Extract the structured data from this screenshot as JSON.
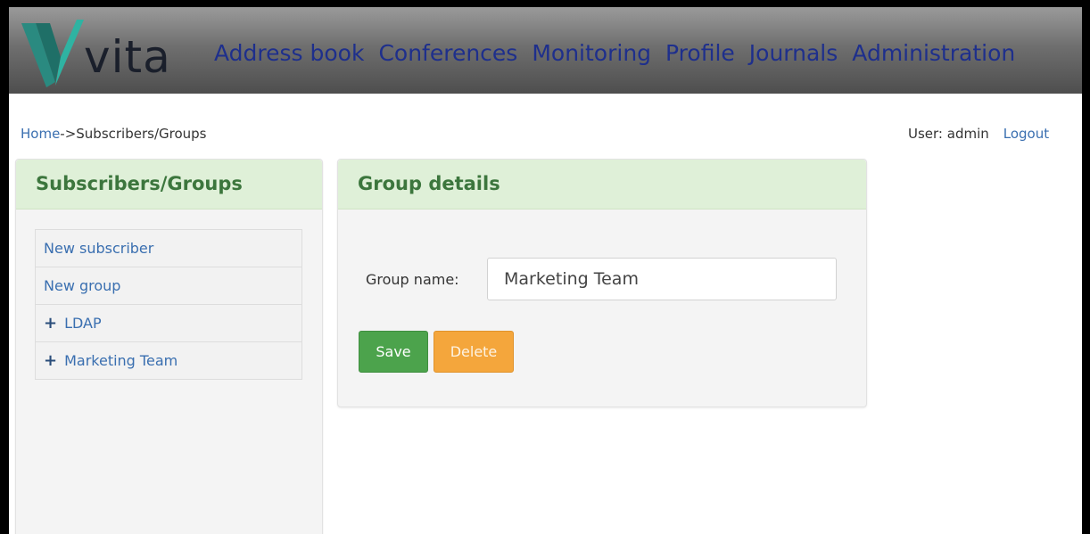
{
  "brand": {
    "logo_text": "vita"
  },
  "nav": [
    {
      "label": "Address book"
    },
    {
      "label": "Conferences"
    },
    {
      "label": "Monitoring"
    },
    {
      "label": "Profile"
    },
    {
      "label": "Journals"
    },
    {
      "label": "Administration"
    }
  ],
  "breadcrumb": {
    "home": "Home",
    "separator": "->",
    "current": "Subscribers/Groups"
  },
  "user": {
    "label": "User: admin",
    "logout": "Logout"
  },
  "sidebar": {
    "title": "Subscribers/Groups",
    "items": [
      {
        "label": "New subscriber",
        "expand": ""
      },
      {
        "label": "New group",
        "expand": ""
      },
      {
        "label": "LDAP",
        "expand": "+"
      },
      {
        "label": "Marketing Team",
        "expand": "+"
      }
    ]
  },
  "details": {
    "title": "Group details",
    "group_name_label": "Group name:",
    "group_name_value": "Marketing Team",
    "save_label": "Save",
    "delete_label": "Delete"
  },
  "colors": {
    "nav_link": "#1e2f8c",
    "panel_header": "#dff0d8",
    "save_button": "#4ca34c",
    "delete_button": "#f4a63c",
    "logo_teal": "#2d9c8f"
  }
}
